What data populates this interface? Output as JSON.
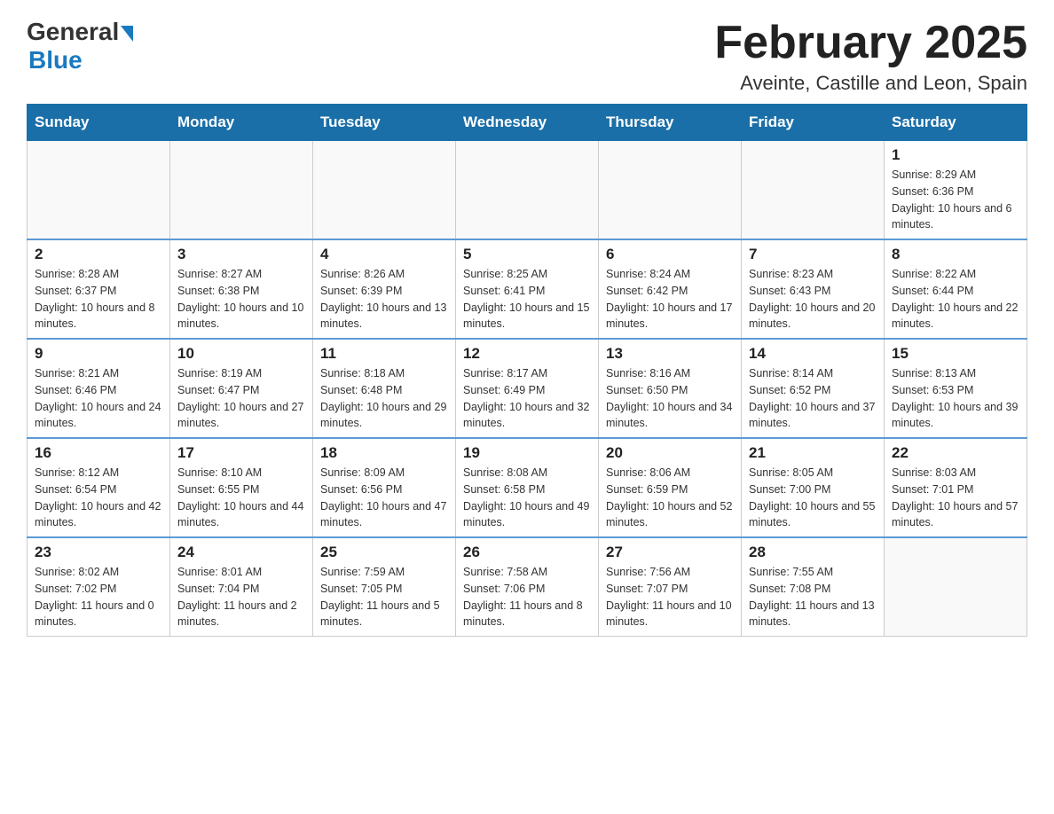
{
  "logo": {
    "general": "General",
    "blue": "Blue"
  },
  "title": "February 2025",
  "subtitle": "Aveinte, Castille and Leon, Spain",
  "days_of_week": [
    "Sunday",
    "Monday",
    "Tuesday",
    "Wednesday",
    "Thursday",
    "Friday",
    "Saturday"
  ],
  "weeks": [
    [
      {
        "day": "",
        "info": ""
      },
      {
        "day": "",
        "info": ""
      },
      {
        "day": "",
        "info": ""
      },
      {
        "day": "",
        "info": ""
      },
      {
        "day": "",
        "info": ""
      },
      {
        "day": "",
        "info": ""
      },
      {
        "day": "1",
        "info": "Sunrise: 8:29 AM\nSunset: 6:36 PM\nDaylight: 10 hours and 6 minutes."
      }
    ],
    [
      {
        "day": "2",
        "info": "Sunrise: 8:28 AM\nSunset: 6:37 PM\nDaylight: 10 hours and 8 minutes."
      },
      {
        "day": "3",
        "info": "Sunrise: 8:27 AM\nSunset: 6:38 PM\nDaylight: 10 hours and 10 minutes."
      },
      {
        "day": "4",
        "info": "Sunrise: 8:26 AM\nSunset: 6:39 PM\nDaylight: 10 hours and 13 minutes."
      },
      {
        "day": "5",
        "info": "Sunrise: 8:25 AM\nSunset: 6:41 PM\nDaylight: 10 hours and 15 minutes."
      },
      {
        "day": "6",
        "info": "Sunrise: 8:24 AM\nSunset: 6:42 PM\nDaylight: 10 hours and 17 minutes."
      },
      {
        "day": "7",
        "info": "Sunrise: 8:23 AM\nSunset: 6:43 PM\nDaylight: 10 hours and 20 minutes."
      },
      {
        "day": "8",
        "info": "Sunrise: 8:22 AM\nSunset: 6:44 PM\nDaylight: 10 hours and 22 minutes."
      }
    ],
    [
      {
        "day": "9",
        "info": "Sunrise: 8:21 AM\nSunset: 6:46 PM\nDaylight: 10 hours and 24 minutes."
      },
      {
        "day": "10",
        "info": "Sunrise: 8:19 AM\nSunset: 6:47 PM\nDaylight: 10 hours and 27 minutes."
      },
      {
        "day": "11",
        "info": "Sunrise: 8:18 AM\nSunset: 6:48 PM\nDaylight: 10 hours and 29 minutes."
      },
      {
        "day": "12",
        "info": "Sunrise: 8:17 AM\nSunset: 6:49 PM\nDaylight: 10 hours and 32 minutes."
      },
      {
        "day": "13",
        "info": "Sunrise: 8:16 AM\nSunset: 6:50 PM\nDaylight: 10 hours and 34 minutes."
      },
      {
        "day": "14",
        "info": "Sunrise: 8:14 AM\nSunset: 6:52 PM\nDaylight: 10 hours and 37 minutes."
      },
      {
        "day": "15",
        "info": "Sunrise: 8:13 AM\nSunset: 6:53 PM\nDaylight: 10 hours and 39 minutes."
      }
    ],
    [
      {
        "day": "16",
        "info": "Sunrise: 8:12 AM\nSunset: 6:54 PM\nDaylight: 10 hours and 42 minutes."
      },
      {
        "day": "17",
        "info": "Sunrise: 8:10 AM\nSunset: 6:55 PM\nDaylight: 10 hours and 44 minutes."
      },
      {
        "day": "18",
        "info": "Sunrise: 8:09 AM\nSunset: 6:56 PM\nDaylight: 10 hours and 47 minutes."
      },
      {
        "day": "19",
        "info": "Sunrise: 8:08 AM\nSunset: 6:58 PM\nDaylight: 10 hours and 49 minutes."
      },
      {
        "day": "20",
        "info": "Sunrise: 8:06 AM\nSunset: 6:59 PM\nDaylight: 10 hours and 52 minutes."
      },
      {
        "day": "21",
        "info": "Sunrise: 8:05 AM\nSunset: 7:00 PM\nDaylight: 10 hours and 55 minutes."
      },
      {
        "day": "22",
        "info": "Sunrise: 8:03 AM\nSunset: 7:01 PM\nDaylight: 10 hours and 57 minutes."
      }
    ],
    [
      {
        "day": "23",
        "info": "Sunrise: 8:02 AM\nSunset: 7:02 PM\nDaylight: 11 hours and 0 minutes."
      },
      {
        "day": "24",
        "info": "Sunrise: 8:01 AM\nSunset: 7:04 PM\nDaylight: 11 hours and 2 minutes."
      },
      {
        "day": "25",
        "info": "Sunrise: 7:59 AM\nSunset: 7:05 PM\nDaylight: 11 hours and 5 minutes."
      },
      {
        "day": "26",
        "info": "Sunrise: 7:58 AM\nSunset: 7:06 PM\nDaylight: 11 hours and 8 minutes."
      },
      {
        "day": "27",
        "info": "Sunrise: 7:56 AM\nSunset: 7:07 PM\nDaylight: 11 hours and 10 minutes."
      },
      {
        "day": "28",
        "info": "Sunrise: 7:55 AM\nSunset: 7:08 PM\nDaylight: 11 hours and 13 minutes."
      },
      {
        "day": "",
        "info": ""
      }
    ]
  ]
}
